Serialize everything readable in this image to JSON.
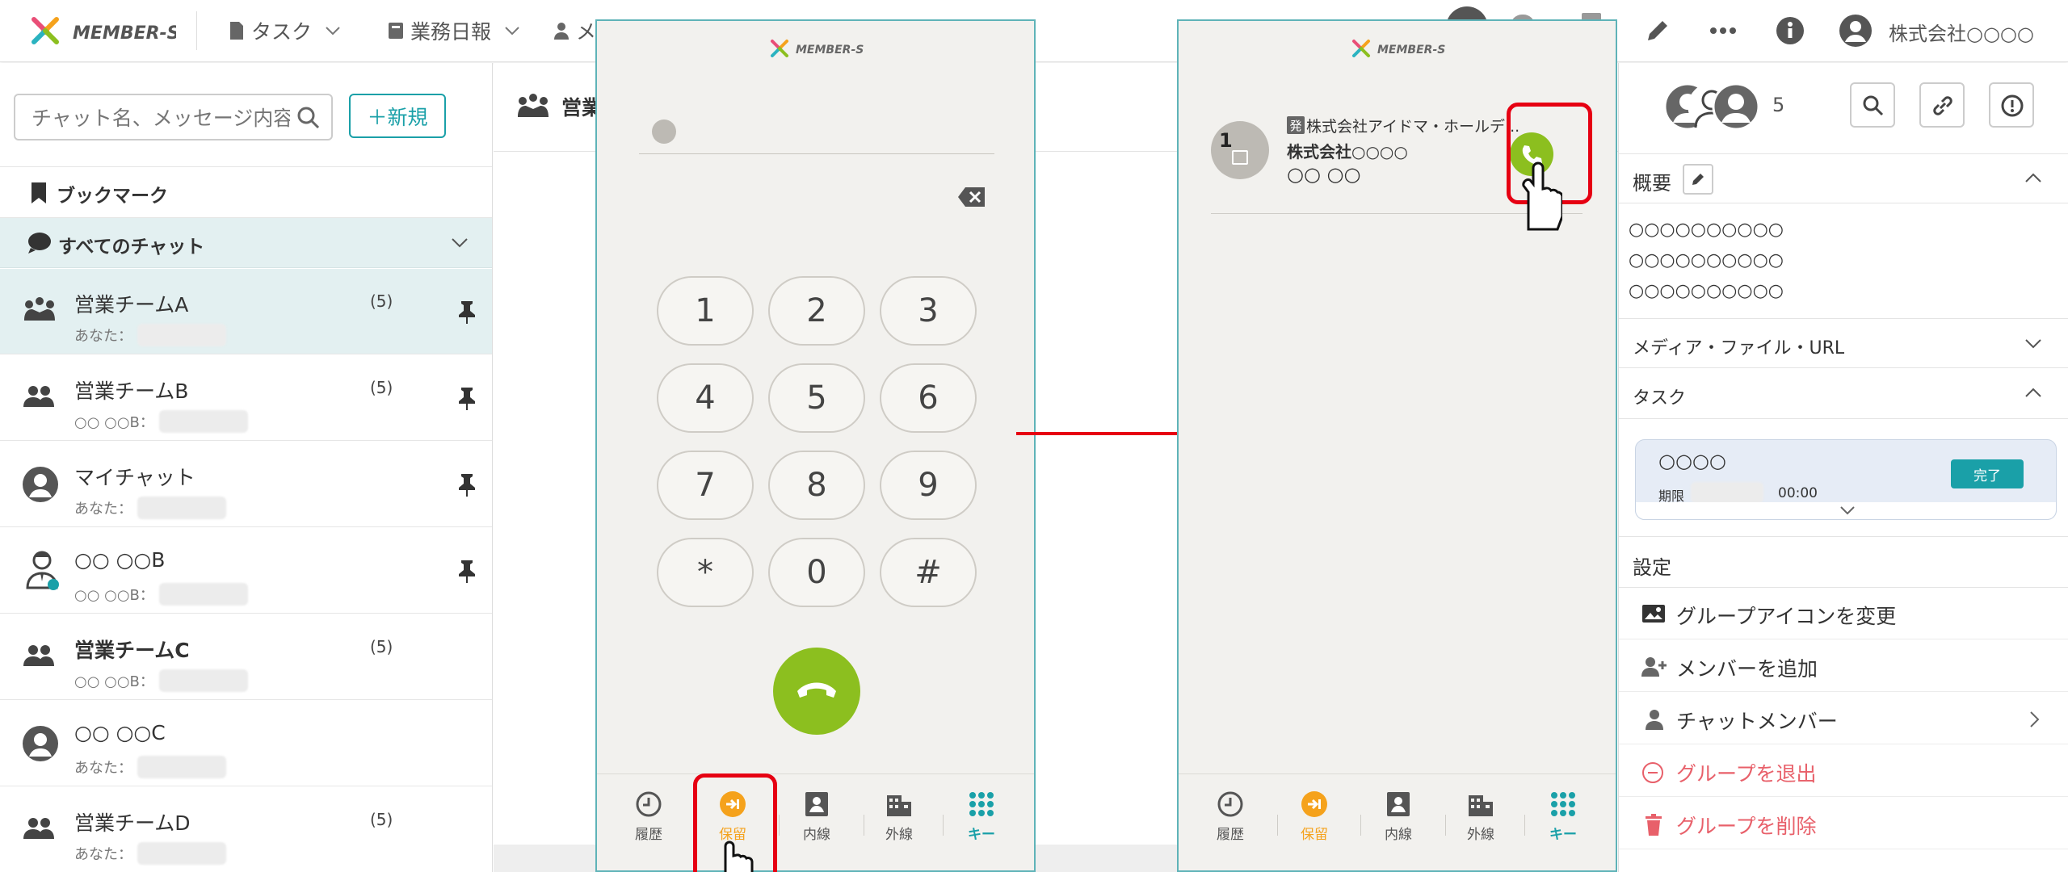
{
  "topbar": {
    "brand": "MEMBER-S",
    "nav": [
      {
        "label": "タスク"
      },
      {
        "label": "業務日報"
      },
      {
        "label": "メ"
      }
    ],
    "company": "株式会社○○○○"
  },
  "sidebar": {
    "search_placeholder": "チャット名、メッセージ内容",
    "new_button": "＋新規",
    "bookmark": "ブックマーク",
    "all_chats": "すべてのチャット",
    "chats": [
      {
        "name": "営業チームA",
        "sub": "あなた：",
        "count": "(5)",
        "pinned": true,
        "icon": "team-crown-icon"
      },
      {
        "name": "営業チームB",
        "sub": "○○ ○○B：",
        "count": "(5)",
        "pinned": true,
        "icon": "group-icon"
      },
      {
        "name": "マイチャット",
        "sub": "あなた：",
        "count": "",
        "pinned": true,
        "icon": "user-circle-icon"
      },
      {
        "name": "○○ ○○B",
        "sub": "○○ ○○B：",
        "count": "",
        "pinned": true,
        "icon": "business-person-icon"
      },
      {
        "name": "営業チームC",
        "sub": "○○ ○○B：",
        "count": "(5)",
        "pinned": false,
        "icon": "group-icon"
      },
      {
        "name": "○○ ○○C",
        "sub": "あなた：",
        "count": "",
        "pinned": false,
        "icon": "user-circle-icon"
      },
      {
        "name": "営業チームD",
        "sub": "あなた：",
        "count": "(5)",
        "pinned": false,
        "icon": "group-icon"
      }
    ]
  },
  "main": {
    "header_title": "営業"
  },
  "phone_left": {
    "brand": "MEMBER-S",
    "keys": [
      "1",
      "2",
      "3",
      "4",
      "5",
      "6",
      "7",
      "8",
      "9",
      "*",
      "0",
      "#"
    ],
    "bottom_nav": [
      "履歴",
      "保留",
      "内線",
      "外線",
      "キー"
    ]
  },
  "phone_right": {
    "brand": "MEMBER-S",
    "held_number": "1",
    "caller_tag": "発",
    "caller_company": "株式会社アイドマ・ホールデ...",
    "caller_org": "株式会社○○○○",
    "caller_name": "○○ ○○",
    "bottom_nav": [
      "履歴",
      "保留",
      "内線",
      "外線",
      "キー"
    ]
  },
  "right_panel": {
    "member_count": "5",
    "overview_label": "概要",
    "overview_lines": [
      "○○○○○○○○○○",
      "○○○○○○○○○○",
      "○○○○○○○○○○"
    ],
    "media_label": "メディア・ファイル・URL",
    "task_label": "タスク",
    "task_title": "○○○○",
    "task_due_label": "期限",
    "task_due_time": "00:00",
    "task_done_button": "完了",
    "settings_label": "設定",
    "settings": [
      {
        "label": "グループアイコンを変更",
        "color": "#333333"
      },
      {
        "label": "メンバーを追加",
        "color": "#333333"
      },
      {
        "label": "チャットメンバー",
        "color": "#333333"
      },
      {
        "label": "グループを退出",
        "color": "#e8606a"
      },
      {
        "label": "グループを削除",
        "color": "#e8606a"
      }
    ]
  },
  "colors": {
    "accent": "#1aa0a8",
    "call_green": "#8cbf1f",
    "hold_orange": "#f5a21c",
    "highlight_red": "#e60012"
  }
}
